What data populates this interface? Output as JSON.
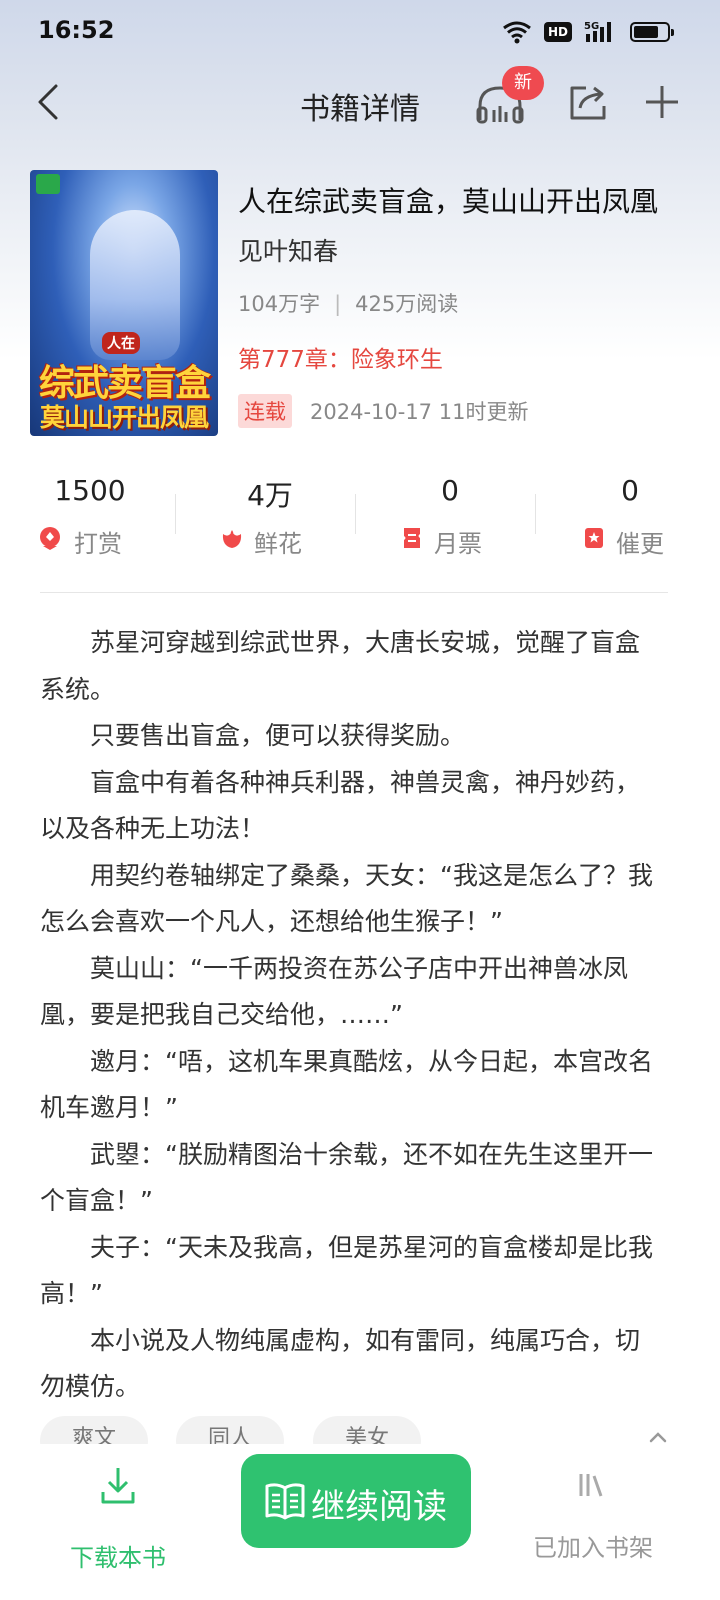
{
  "status_bar": {
    "time": "16:52",
    "network": "5G",
    "hd": "HD",
    "battery_percent": 75
  },
  "nav": {
    "title": "书籍详情",
    "new_badge": "新"
  },
  "book": {
    "cover_line1": "人在",
    "cover_line2": "综武卖盲盒",
    "cover_line3": "莫山山开出凤凰",
    "title": "人在综武卖盲盒，莫山山开出凤凰",
    "author": "见叶知春",
    "word_count": "104万字",
    "reads": "425万阅读",
    "latest_chapter": "第777章：险象环生",
    "status": "连载",
    "updated": "2024-10-17 11时更新"
  },
  "stats": [
    {
      "value": "1500",
      "label": "打赏",
      "icon": "reward-icon"
    },
    {
      "value": "4万",
      "label": "鲜花",
      "icon": "flower-icon"
    },
    {
      "value": "0",
      "label": "月票",
      "icon": "ticket-icon"
    },
    {
      "value": "0",
      "label": "催更",
      "icon": "urge-icon"
    }
  ],
  "synopsis": [
    "苏星河穿越到综武世界，大唐长安城，觉醒了盲盒系统。",
    "只要售出盲盒，便可以获得奖励。",
    "盲盒中有着各种神兵利器，神兽灵禽，神丹妙药，以及各种无上功法！",
    "用契约卷轴绑定了桑桑，天女：“我这是怎么了？我怎么会喜欢一个凡人，还想给他生猴子！”",
    "莫山山：“一千两投资在苏公子店中开出神兽冰凤凰，要是把我自己交给他，……”",
    "邀月：“唔，这机车果真酷炫，从今日起，本宫改名机车邀月！”",
    "武曌：“朕励精图治十余载，还不如在先生这里开一个盲盒！”",
    "夫子：“天未及我高，但是苏星河的盲盒楼却是比我高！”",
    "本小说及人物纯属虚构，如有雷同，纯属巧合，切勿模仿。"
  ],
  "tags": [
    "爽文",
    "同人",
    "美女"
  ],
  "bottom_bar": {
    "download": "下载本书",
    "continue": "继续阅读",
    "shelf": "已加入书架"
  },
  "colors": {
    "accent_green": "#2fc270",
    "accent_red": "#e5473f"
  }
}
